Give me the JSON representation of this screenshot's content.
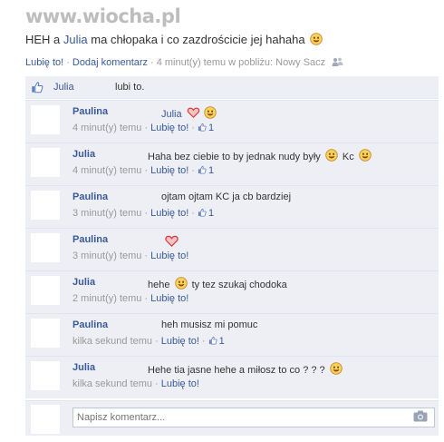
{
  "watermark": "www.wiocha.pl",
  "post": {
    "text_before": "HEH a ",
    "mentioned": "Julia",
    "text_after": " ma chłopaka i co zazdrościcie jej hahaha",
    "like_link": "Lubię to!",
    "comment_link": "Dodaj komentarz",
    "time": "4 minut(y) temu w pobliżu: Nowy Sacz"
  },
  "likes": {
    "who": "Julia",
    "rest": "lubi to."
  },
  "comments": [
    {
      "author": "Paulina",
      "text": "Julia",
      "emojis": [
        "heart-icon",
        "smiley-icon"
      ],
      "time": "4 minut(y) temu",
      "like_label": "Lubię to!",
      "like_count": "1"
    },
    {
      "author": "Julia",
      "text": "Haha bez ciebie to by jednak nudy były",
      "emojis": [
        "smiley-icon"
      ],
      "text2": " Kc",
      "emojis2": [
        "smiley-icon"
      ],
      "time": "4 minut(y) temu",
      "like_label": "Lubię to!",
      "like_count": "1"
    },
    {
      "author": "Paulina",
      "text": "ojtam ojtam KC ja cb bardziej",
      "emojis": [],
      "time": "3 minut(y) temu",
      "like_label": "Lubię to!",
      "like_count": "1"
    },
    {
      "author": "Paulina",
      "text": "",
      "emojis": [
        "heart-icon"
      ],
      "time": "3 minut(y) temu",
      "like_label": "Lubię to!",
      "like_count": ""
    },
    {
      "author": "Julia",
      "text": "hehe",
      "emojis": [
        "smiley-icon"
      ],
      "text2": " ty tez szukaj chodoka",
      "time": "2 minut(y) temu",
      "like_label": "Lubię to!",
      "like_count": ""
    },
    {
      "author": "Paulina",
      "text": "heh musisz mi pomuc",
      "emojis": [],
      "time": "kilka sekund temu",
      "like_label": "Lubię to!",
      "like_count": "1"
    },
    {
      "author": "Julia",
      "text": "Hehe tia jasne hehe a miłosz to co ? ? ?",
      "emojis": [
        "smiley-icon"
      ],
      "time": "kilka sekund temu",
      "like_label": "Lubię to!",
      "like_count": ""
    }
  ],
  "composer": {
    "placeholder": "Napisz komentarz..."
  },
  "colors": {
    "link": "#3b5998",
    "panel": "#edeff4",
    "meta": "#999999"
  }
}
